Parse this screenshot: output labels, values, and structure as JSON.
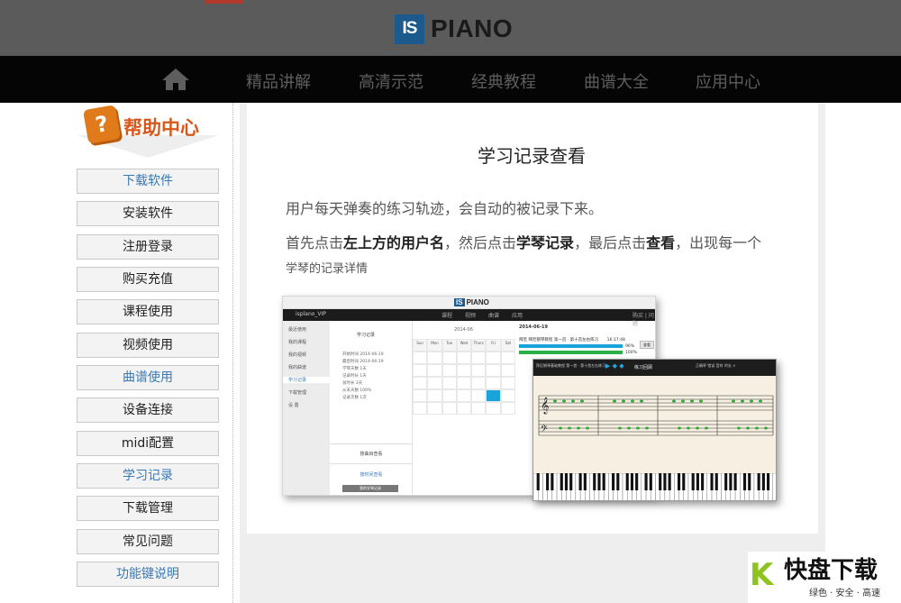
{
  "header": {
    "logo_mark": "IS",
    "logo_text": "PIANO"
  },
  "nav": {
    "home_icon": "home-icon",
    "items": [
      "精品讲解",
      "高清示范",
      "经典教程",
      "曲谱大全",
      "应用中心"
    ]
  },
  "sidebar": {
    "badge": "?",
    "title": "帮助中心",
    "items": [
      {
        "label": "下载软件",
        "active": true
      },
      {
        "label": "安装软件",
        "active": false
      },
      {
        "label": "注册登录",
        "active": false
      },
      {
        "label": "购买充值",
        "active": false
      },
      {
        "label": "课程使用",
        "active": false
      },
      {
        "label": "视频使用",
        "active": false
      },
      {
        "label": "曲谱使用",
        "active": true
      },
      {
        "label": "设备连接",
        "active": false
      },
      {
        "label": "midi配置",
        "active": false
      },
      {
        "label": "学习记录",
        "active": true
      },
      {
        "label": "下载管理",
        "active": false
      },
      {
        "label": "常见问题",
        "active": false
      },
      {
        "label": "功能键说明",
        "active": true
      }
    ]
  },
  "main": {
    "title": "学习记录查看",
    "para1": "用户每天弹奏的练习轨迹，会自动的被记录下来。",
    "para2_a": "首先点击",
    "para2_b": "左上方的用户名",
    "para2_c": "，然后点击",
    "para2_d": "学琴记录",
    "para2_e": "，最后点击",
    "para2_f": "查看",
    "para2_g": "，出现每一个",
    "para3": "学琴的记录详情"
  },
  "screenshot": {
    "logo_mark": "IS",
    "logo_text": "PIANO",
    "user": "isplano_VIP",
    "nav": [
      "课程",
      "视频",
      "曲谱",
      "应用"
    ],
    "nav_right": "购买 | 问题",
    "side_items": [
      "最近使用",
      "我的课程",
      "我的视频",
      "我的曲谱",
      "学习记录",
      "下载管理",
      "设 置"
    ],
    "col2_title": "学习记录",
    "col2_rows": [
      "开始时间  2014-06-19",
      "最后时间  2014-06-19",
      "学琴天数  1天",
      "记录时长  1天",
      "总时长    3天",
      "从未天数  100%",
      "记录次数  1次"
    ],
    "btn_by_day": "按曲目查看",
    "btn_by_time": "按时间查看",
    "btn_dark": "我的学琴记录",
    "month": "2014-06",
    "weekdays": [
      "Sun",
      "Mon",
      "Tue",
      "Wed",
      "Thurs",
      "Fri",
      "Sat"
    ],
    "date_head": "2014-06-19",
    "record_line": "拜厄 拜厄钢琴教程 第一首 · 第十首左右练习",
    "record_time": "16:17:48",
    "pct1": "96%",
    "pct2": "100%",
    "view_btn": "查看"
  },
  "score": {
    "title": "练习回顾",
    "left_text": "拜厄钢琴基础教程 第一首 · 第十首左右练习",
    "right_text": "正确率  错误  音符  时长  ×"
  },
  "watermark": {
    "mark": "K",
    "title": "快盘下载",
    "subtitle": "绿色 · 安全 · 高速"
  },
  "colors": {
    "header_bg": "#5b5b5b",
    "nav_bg": "#050505",
    "accent_orange": "#d8561a",
    "link_blue": "#3b79b4",
    "brand_blue": "#1c5a8d"
  }
}
